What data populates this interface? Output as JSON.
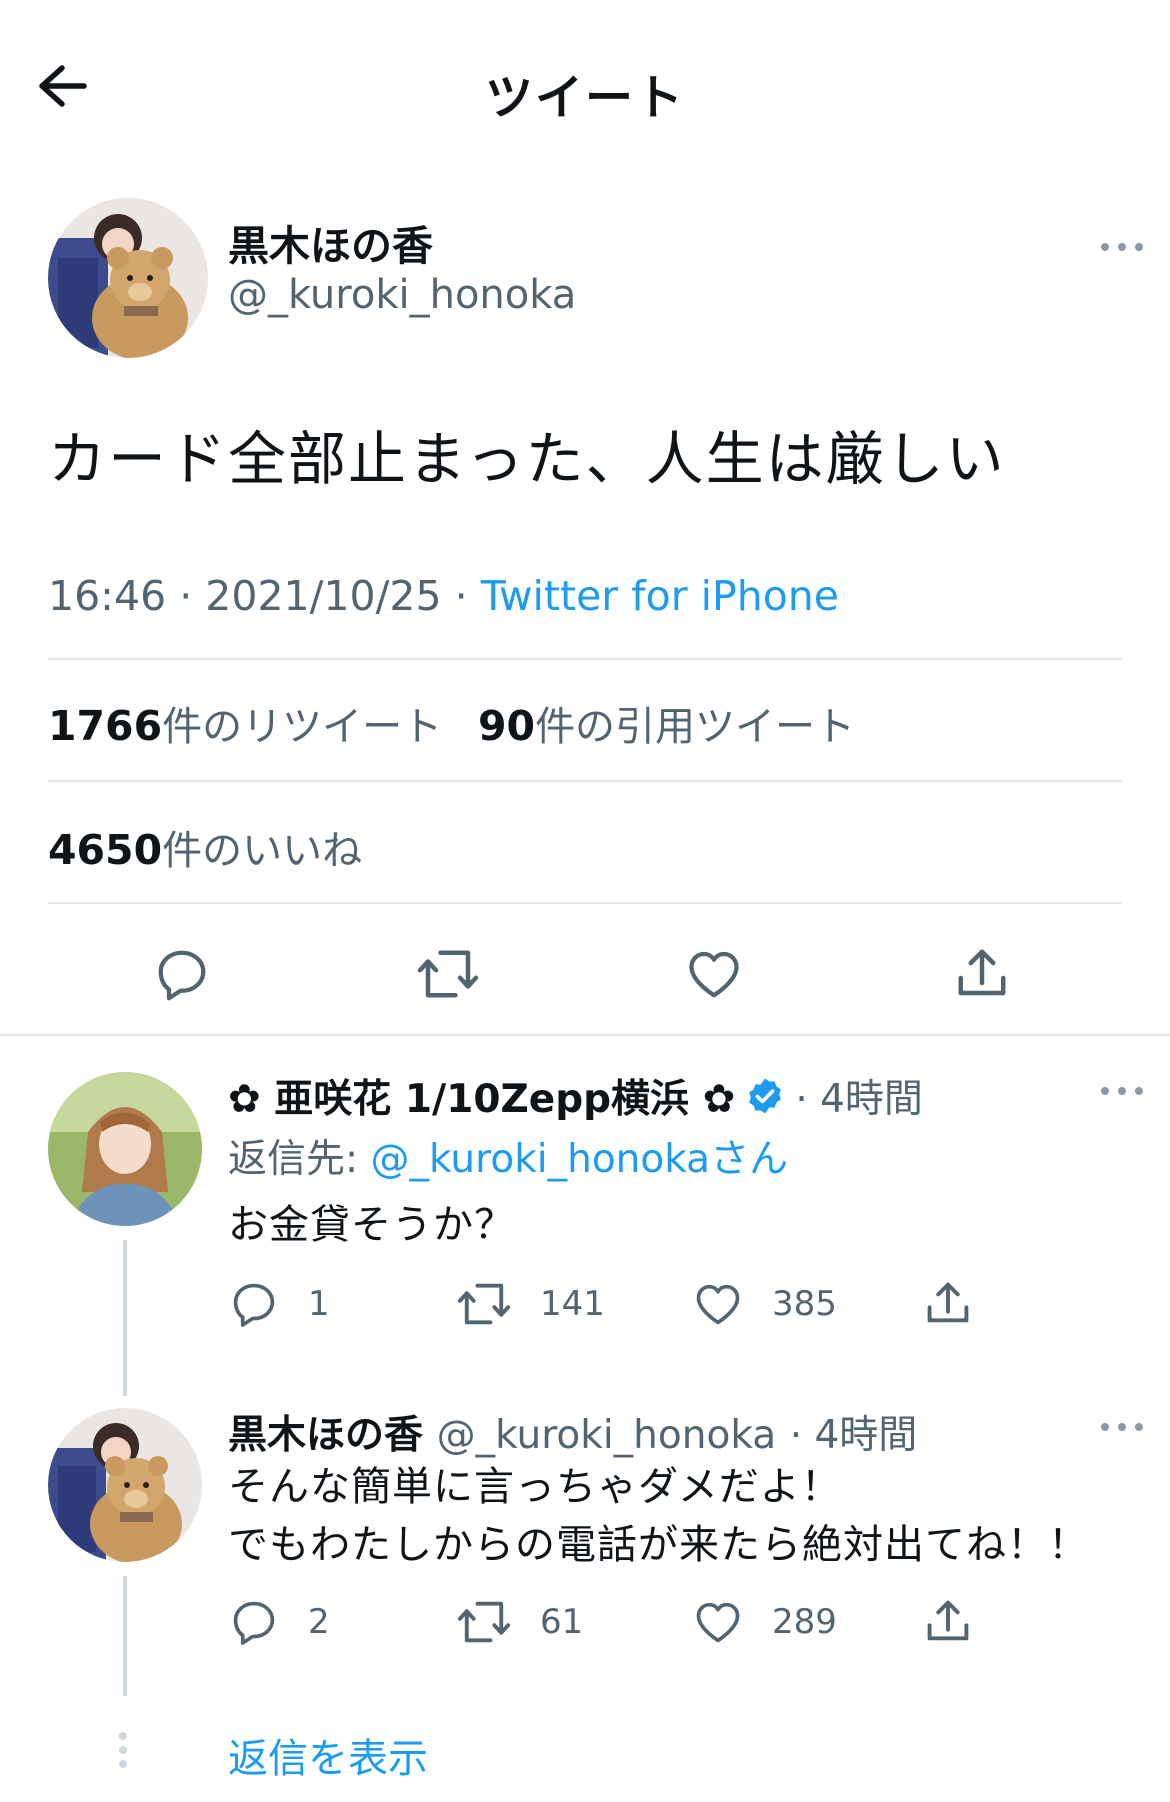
{
  "header": {
    "title": "ツイート"
  },
  "main_tweet": {
    "author_name": "黒木ほの香",
    "author_handle": "@_kuroki_honoka",
    "text": "カード全部止まった、人生は厳しい",
    "time": "16:46",
    "date": "2021/10/25",
    "separator": "·",
    "source": "Twitter for iPhone",
    "retweets_count": "1766",
    "retweets_label": "件のリツイート",
    "quotes_count": "90",
    "quotes_label": "件の引用ツイート",
    "likes_count": "4650",
    "likes_label": "件のいいね"
  },
  "replies": [
    {
      "author_name": "✿ 亜咲花 1/10Zepp横浜 ✿",
      "verified": true,
      "time_ago": "· 4時間",
      "reply_to_prefix": "返信先: ",
      "reply_to_handle": "@_kuroki_honoka",
      "reply_to_suffix": "さん",
      "text": "お金貸そうか？",
      "reply_count": "1",
      "retweet_count": "141",
      "like_count": "385"
    },
    {
      "author_name": "黒木ほの香",
      "author_handle": "@_kuroki_honoka",
      "time_ago": "· 4時間",
      "text_line1": "そんな簡単に言っちゃダメだよ！",
      "text_line2": "でもわたしからの電話が来たら絶対出てね！！",
      "reply_count": "2",
      "retweet_count": "61",
      "like_count": "289"
    }
  ],
  "show_replies_label": "返信を表示",
  "colors": {
    "accent": "#1d9bf0",
    "text": "#0f1419",
    "secondary": "#536471",
    "divider": "#e4e8eb"
  },
  "icons": [
    "back-arrow-icon",
    "more-icon",
    "reply-icon",
    "retweet-icon",
    "like-icon",
    "share-icon",
    "verified-icon"
  ]
}
